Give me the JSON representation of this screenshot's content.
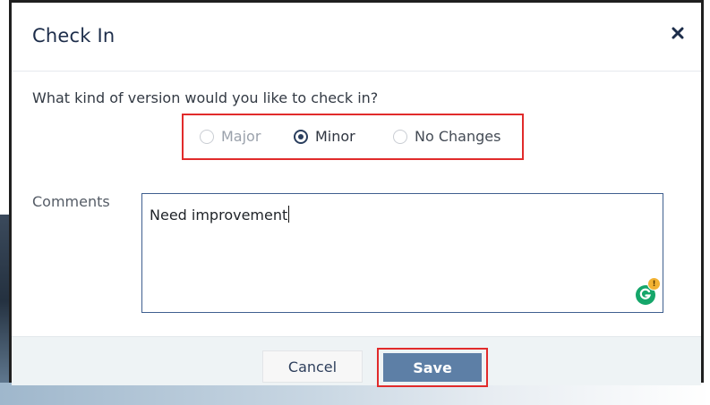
{
  "dialog": {
    "title": "Check In",
    "close_icon": "close-icon"
  },
  "version": {
    "question": "What kind of version would you like to check in?",
    "options": [
      {
        "label": "Major",
        "state": "disabled"
      },
      {
        "label": "Minor",
        "state": "selected"
      },
      {
        "label": "No Changes",
        "state": "normal"
      }
    ],
    "highlight_color": "#e12b2b"
  },
  "comments": {
    "label": "Comments",
    "value": "Need improvement"
  },
  "footer": {
    "cancel_label": "Cancel",
    "save_label": "Save"
  },
  "colors": {
    "accent": "#5d7fa6",
    "title": "#1d2d4a",
    "highlight": "#e12b2b",
    "grammarly": "#15a66a"
  },
  "icons": [
    "close-icon",
    "grammarly-icon"
  ]
}
